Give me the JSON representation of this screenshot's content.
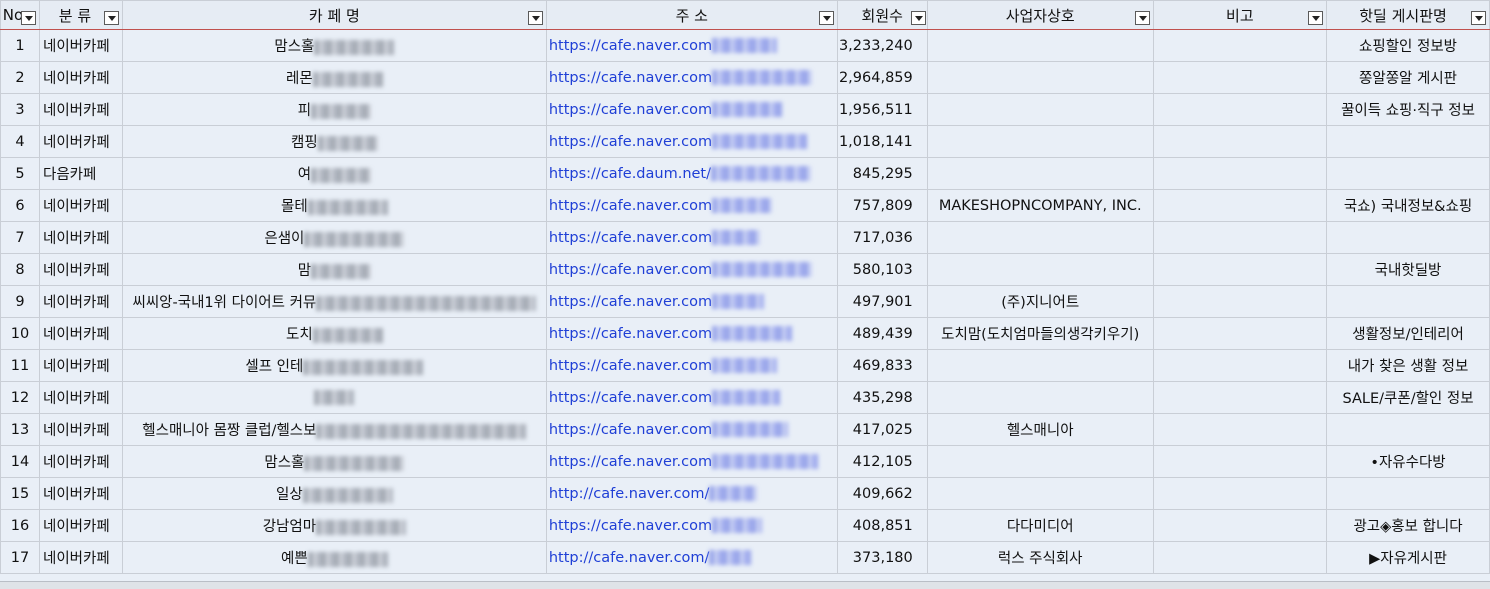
{
  "headers": {
    "no": "No",
    "category": "분 류",
    "cafe": "카 페 명",
    "address": "주 소",
    "members": "회원수",
    "business": "사업자상호",
    "note": "비고",
    "board": "핫딜 게시판명"
  },
  "rows": [
    {
      "no": "1",
      "category": "네이버카페",
      "name": "맘스홀",
      "url": "https://cafe.naver.com",
      "members": "3,233,240",
      "business": "",
      "note": "",
      "board": "쇼핑할인 정보방"
    },
    {
      "no": "2",
      "category": "네이버카페",
      "name": "레몬",
      "url": "https://cafe.naver.com",
      "members": "2,964,859",
      "business": "",
      "note": "",
      "board": "쫑알쫑알 게시판"
    },
    {
      "no": "3",
      "category": "네이버카페",
      "name": "피",
      "url": "https://cafe.naver.com",
      "members": "1,956,511",
      "business": "",
      "note": "",
      "board": "꿀이득 쇼핑·직구 정보"
    },
    {
      "no": "4",
      "category": "네이버카페",
      "name": "캠핑",
      "url": "https://cafe.naver.com",
      "members": "1,018,141",
      "business": "",
      "note": "",
      "board": ""
    },
    {
      "no": "5",
      "category": "다음카페",
      "name": "여",
      "url": "https://cafe.daum.net/",
      "members": "845,295",
      "business": "",
      "note": "",
      "board": ""
    },
    {
      "no": "6",
      "category": "네이버카페",
      "name": "몰테",
      "url": "https://cafe.naver.com",
      "members": "757,809",
      "business": "MAKESHOPNCOMPANY, INC.",
      "note": "",
      "board": "국쇼) 국내정보&쇼핑"
    },
    {
      "no": "7",
      "category": "네이버카페",
      "name": "은샘이",
      "url": "https://cafe.naver.com",
      "members": "717,036",
      "business": "",
      "note": "",
      "board": ""
    },
    {
      "no": "8",
      "category": "네이버카페",
      "name": "맘",
      "url": "https://cafe.naver.com",
      "members": "580,103",
      "business": "",
      "note": "",
      "board": "국내핫딜방"
    },
    {
      "no": "9",
      "category": "네이버카페",
      "name": "씨씨앙-국내1위 다이어트 커뮤",
      "url": "https://cafe.naver.com",
      "members": "497,901",
      "business": "(주)지니어트",
      "note": "",
      "board": ""
    },
    {
      "no": "10",
      "category": "네이버카페",
      "name": "도치",
      "url": "https://cafe.naver.com",
      "members": "489,439",
      "business": "도치맘(도치엄마들의생각키우기)",
      "note": "",
      "board": "생활정보/인테리어"
    },
    {
      "no": "11",
      "category": "네이버카페",
      "name": "셀프 인테",
      "url": "https://cafe.naver.com",
      "members": "469,833",
      "business": "",
      "note": "",
      "board": "내가 찾은 생활 정보"
    },
    {
      "no": "12",
      "category": "네이버카페",
      "name": "",
      "url": "https://cafe.naver.com",
      "members": "435,298",
      "business": "",
      "note": "",
      "board": "SALE/쿠폰/할인 정보"
    },
    {
      "no": "13",
      "category": "네이버카페",
      "name": "헬스매니아 몸짱 클럽/헬스보",
      "url": "https://cafe.naver.com",
      "members": "417,025",
      "business": "헬스매니아",
      "note": "",
      "board": ""
    },
    {
      "no": "14",
      "category": "네이버카페",
      "name": "맘스홀",
      "url": "https://cafe.naver.com",
      "members": "412,105",
      "business": "",
      "note": "",
      "board": "•자유수다방"
    },
    {
      "no": "15",
      "category": "네이버카페",
      "name": "일상",
      "url": "http://cafe.naver.com/",
      "members": "409,662",
      "business": "",
      "note": "",
      "board": ""
    },
    {
      "no": "16",
      "category": "네이버카페",
      "name": "강남엄마",
      "url": "https://cafe.naver.com",
      "members": "408,851",
      "business": "다다미디어",
      "note": "",
      "board": "광고◈홍보 합니다"
    },
    {
      "no": "17",
      "category": "네이버카페",
      "name": "예쁜",
      "url": "http://cafe.naver.com/",
      "members": "373,180",
      "business": "럭스 주식회사",
      "note": "",
      "board": "▶자유게시판"
    }
  ]
}
